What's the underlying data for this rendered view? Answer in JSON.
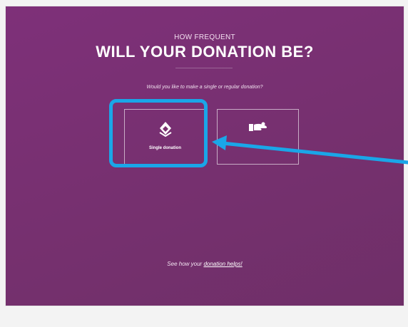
{
  "header": {
    "subtitle": "HOW FREQUENT",
    "title": "WILL YOUR DONATION BE?"
  },
  "question": "Would you like to make a single or regular donation?",
  "options": [
    {
      "label": "Single donation",
      "icon": "heart-diamond-icon"
    },
    {
      "label": "",
      "icon": "hand-giving-icon"
    }
  ],
  "footer": {
    "prefix": "See how your ",
    "link_label": "donation helps!"
  },
  "colors": {
    "background": "#7a306f",
    "highlight": "#1aa6e8",
    "page": "#f3f3f3"
  }
}
